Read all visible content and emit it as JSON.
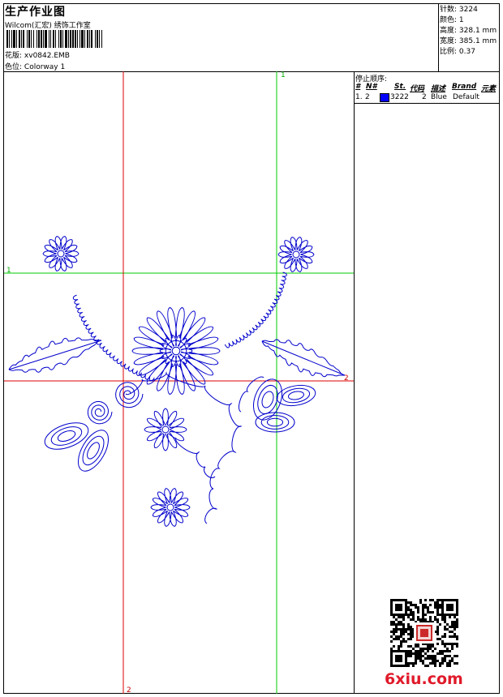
{
  "header": {
    "title": "生产作业图",
    "company": "Wilcom(汇宏) 绣饰工作室",
    "design_label": "花版:",
    "design_file": "xv0842.EMB",
    "colorway_label": "色位:",
    "colorway": "Colorway 1"
  },
  "stats": {
    "stitches_label": "针数:",
    "stitches": "3224",
    "colors_label": "颜色:",
    "colors": "1",
    "height_label": "高度:",
    "height": "328.1 mm",
    "width_label": "宽度:",
    "width": "385.1 mm",
    "scale_label": "比例:",
    "scale": "0.37"
  },
  "stop_sequence": {
    "title": "停止顺序:",
    "headers": {
      "idx": "#",
      "num": "N#",
      "st": "St.",
      "code": "代码",
      "desc": "描述",
      "brand": "Brand",
      "element": "元素"
    },
    "rows": [
      {
        "idx": "1.",
        "num": "2",
        "st": "3222",
        "code": "2",
        "desc": "Blue",
        "brand": "Default",
        "swatch_color": "#0000ff"
      }
    ]
  },
  "guides": {
    "green_top": "1",
    "green_left": "1",
    "red_right": "2",
    "red_bottom": "2"
  },
  "colors": {
    "thread": "#0000cc",
    "guide_green": "#00cc00",
    "guide_red": "#dd0000",
    "watermark": "#e01a2a"
  },
  "watermark": "6xiu.com"
}
